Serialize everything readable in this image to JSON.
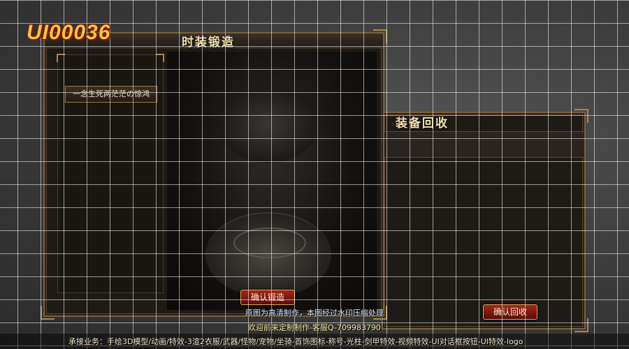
{
  "ui_code": "UI00036",
  "forge_panel": {
    "title": "时装锻造",
    "list_items": [
      "一念生死两茫茫の惊鸿"
    ],
    "confirm_button": "确认锻造"
  },
  "recycle_panel": {
    "title": "装备回收",
    "confirm_button": "确认回收"
  },
  "notices": {
    "line1": "原图为高清制作，本图经过水印压缩处理",
    "line2": "欢迎前来定制制作-客服Q-709983790"
  },
  "footer": {
    "text": "承接业务：手绘3D模型/动画/特效-3渲2衣服/武器/怪物/宠物/坐骑-首饰图标-称号-光柱-剑甲特效-视频特效-UI对话框按钮-UI特效-logo"
  },
  "colors": {
    "title_gold": "#f1dfaa",
    "code_gold": "#f6c340",
    "button_red": "#a2261c",
    "frame_bronze": "#7a6040",
    "notice_blue": "#cfe3ff",
    "notice_yellow": "#f7e7a0"
  }
}
